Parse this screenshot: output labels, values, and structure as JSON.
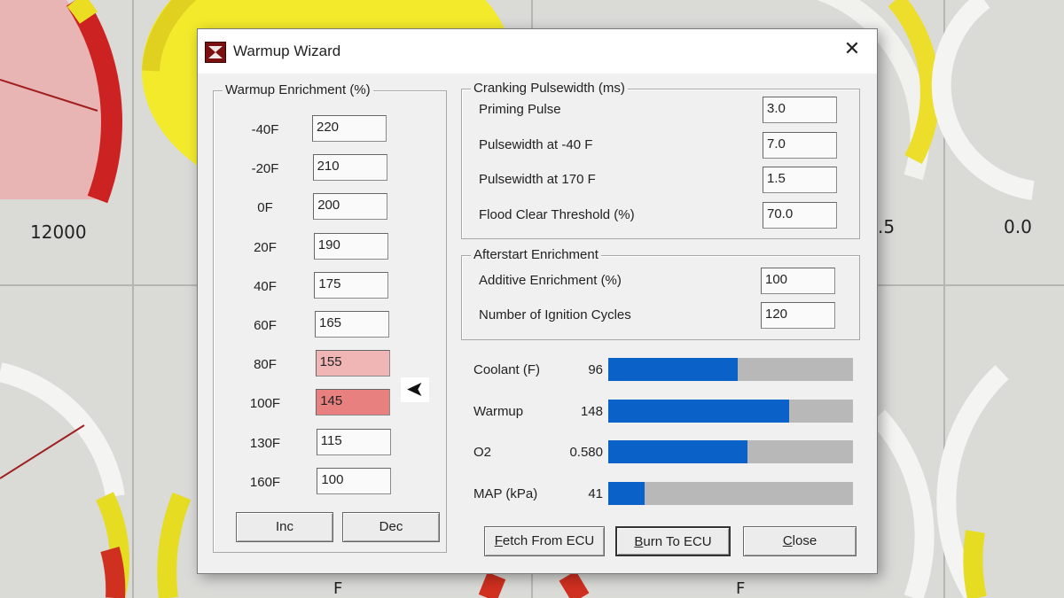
{
  "background": {
    "readout_left": "12000",
    "readout_mid": ".5",
    "readout_right": "0.0",
    "unit_a": "F",
    "unit_b": "F"
  },
  "dialog": {
    "title": "Warmup Wizard",
    "close_glyph": "✕",
    "warmup": {
      "legend": "Warmup Enrichment (%)",
      "rows": [
        {
          "label": "-40F",
          "value": "220"
        },
        {
          "label": "-20F",
          "value": "210"
        },
        {
          "label": "0F",
          "value": "200"
        },
        {
          "label": "20F",
          "value": "190"
        },
        {
          "label": "40F",
          "value": "175"
        },
        {
          "label": "60F",
          "value": "165"
        },
        {
          "label": "80F",
          "value": "155"
        },
        {
          "label": "100F",
          "value": "145"
        },
        {
          "label": "130F",
          "value": "115"
        },
        {
          "label": "160F",
          "value": "100"
        }
      ],
      "highlight_colors": [
        "#f0b5b5",
        "#e88080"
      ],
      "inc_label": "Inc",
      "dec_label": "Dec",
      "marker_glyph": "➤"
    },
    "cranking": {
      "legend": "Cranking Pulsewidth (ms)",
      "fields": [
        {
          "label": "Priming Pulse",
          "value": "3.0"
        },
        {
          "label": "Pulsewidth at -40 F",
          "value": "7.0"
        },
        {
          "label": "Pulsewidth at  170 F",
          "value": "1.5"
        },
        {
          "label": "Flood Clear Threshold (%)",
          "value": "70.0"
        }
      ]
    },
    "afterstart": {
      "legend": "Afterstart Enrichment",
      "fields": [
        {
          "label": "Additive Enrichment (%)",
          "value": "100"
        },
        {
          "label": "Number of Ignition Cycles",
          "value": "120"
        }
      ]
    },
    "gauges": [
      {
        "label": "Coolant (F)",
        "value": "96",
        "fill_fraction": 0.53
      },
      {
        "label": "Warmup",
        "value": "148",
        "fill_fraction": 0.74
      },
      {
        "label": "O2",
        "value": "0.580",
        "fill_fraction": 0.57
      },
      {
        "label": "MAP (kPa)",
        "value": "41",
        "fill_fraction": 0.15
      }
    ],
    "bar_color": "#0a62c8",
    "buttons": {
      "fetch": "Fetch From ECU",
      "burn": "Burn To ECU",
      "close": "Close"
    }
  }
}
